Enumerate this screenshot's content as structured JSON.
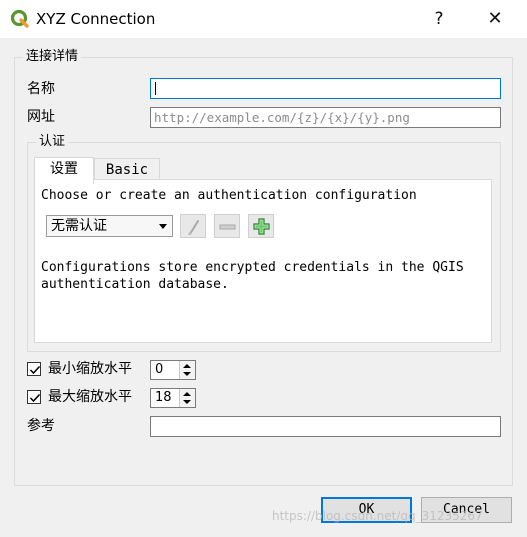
{
  "window": {
    "title": "XYZ Connection",
    "help_glyph": "?",
    "close_glyph": "✕",
    "app_icon": "qgis-logo-icon"
  },
  "connection_details": {
    "group_title": "连接详情",
    "name_label": "名称",
    "name_value": "",
    "url_label": "网址",
    "url_placeholder": "http://example.com/{z}/{x}/{y}.png"
  },
  "auth": {
    "group_title": "认证",
    "tabs": [
      {
        "label": "设置",
        "active": true
      },
      {
        "label": "Basic",
        "active": false
      }
    ],
    "prompt": "Choose or create an authentication configuration",
    "config_select": "无需认证",
    "edit_icon": "pencil-icon",
    "remove_icon": "minus-icon",
    "add_icon": "plus-icon",
    "info_line1": "Configurations store encrypted credentials in the QGIS",
    "info_line2": "authentication database."
  },
  "zoom": {
    "min_label": "最小缩放水平",
    "min_checked": true,
    "min_value": "0",
    "max_label": "最大缩放水平",
    "max_checked": true,
    "max_value": "18"
  },
  "referer": {
    "label": "参考",
    "value": ""
  },
  "buttons": {
    "ok": "OK",
    "cancel": "Cancel"
  },
  "watermark": "https://blog.csdn.net/qq_31235267",
  "colors": {
    "focus_border": "#0078d7",
    "qgis_green": "#589632",
    "qgis_yellow": "#ee9a2d",
    "add_green": "#3ba03b"
  }
}
